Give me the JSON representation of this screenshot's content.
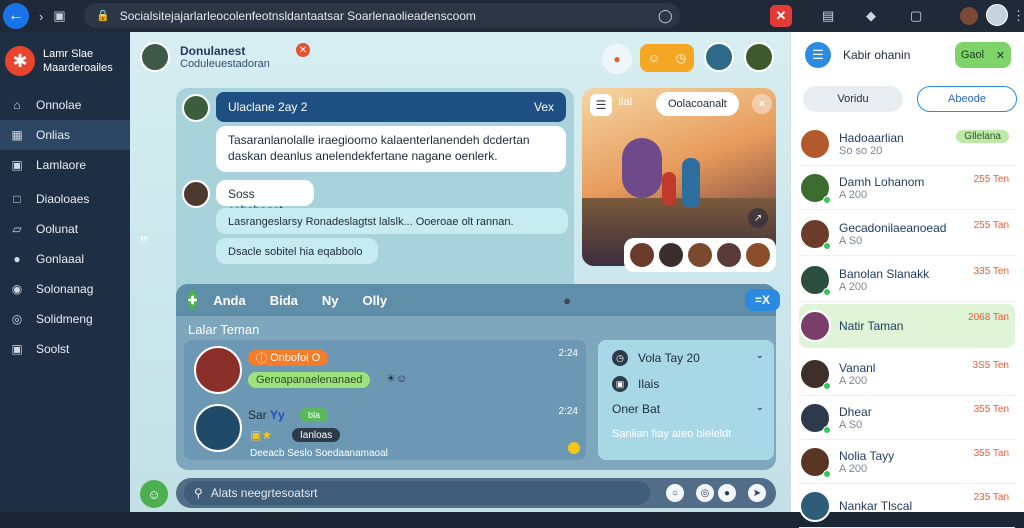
{
  "browser": {
    "url": "Socialsitejajarlarleocolenfeotnsldantaatsar Soarlenaolieadenscoom",
    "back_icon": "arrow-left-icon"
  },
  "sidebar": {
    "brand_line1": "Lamr Slae",
    "brand_line2": "Maarderoailes",
    "items": [
      {
        "label": "Onnolae",
        "icon": "home-icon"
      },
      {
        "label": "Onlias",
        "icon": "grid-icon"
      },
      {
        "label": "Lamlaore",
        "icon": "calendar-icon"
      },
      {
        "label": "Diaoloaes",
        "icon": "document-icon"
      },
      {
        "label": "Oolunat",
        "icon": "chat-icon"
      },
      {
        "label": "Gonlaaal",
        "icon": "settings-icon"
      },
      {
        "label": "Solonanag",
        "icon": "people-icon"
      },
      {
        "label": "Solidmeng",
        "icon": "bell-icon"
      },
      {
        "label": "Soolst",
        "icon": "folder-icon"
      }
    ]
  },
  "header": {
    "title": "Donulanest",
    "subtitle": "Coduleuestadoran"
  },
  "chat": {
    "title": "Ulaclane 2ay 2",
    "close_label": "Vex",
    "message1": "Tasaranlanolalle iraegioomo kalaenterlanendeh dcdertan daskan deanlus anelendekfertane nagane oenlerk.",
    "message2": "Soss cobsbaast",
    "message3": "Lasrangeslarsy Ronadeslagtst lalslk...    Ooeroae olt rannan.",
    "message4": "Dsacle sobitel  hia  eqabbolo"
  },
  "image_card": {
    "title": "Oolacoanalt",
    "badge": "Ilal"
  },
  "friends": {
    "tabs": [
      "Anda",
      "Bida",
      "Ny",
      "Olly"
    ],
    "action_label": "=X",
    "section_title": "Lalar Teman",
    "friend1": {
      "tag": "Onbofol O",
      "detail": "Geroapanaelenanaed",
      "time": "2:24"
    },
    "friend2": {
      "name": "Sar",
      "name_accent": "Yy",
      "tag": "bla",
      "badge": "Ianloas",
      "detail": "Deeacb  Seslo  Soedaanamaoal",
      "time": "2:24"
    },
    "side": {
      "line1": "Vola Tay 20",
      "line2": "Ilais",
      "line3": "Oner  Bat",
      "line4": "Saniian fiay ateo bleleldt"
    }
  },
  "composer": {
    "placeholder": "Alats neegrtesoatsrt"
  },
  "right_panel": {
    "title": "Kabir ohanin",
    "status_label": "Gaol",
    "tab1": "Voridu",
    "tab2": "Abeode",
    "contacts": [
      {
        "name": "Hadoaarlian",
        "sub": "So so 20",
        "time": "Gllelana",
        "online": false,
        "highlight": false,
        "color": "#b35a2c"
      },
      {
        "name": "Damh Lohanom",
        "sub": "A 200",
        "time": "255 Ten",
        "online": true,
        "highlight": false,
        "color": "#3b6b2f"
      },
      {
        "name": "Gecadonilaeanoead",
        "sub": "A  S0",
        "time": "255 Tan",
        "online": true,
        "highlight": false,
        "color": "#6b3c2a"
      },
      {
        "name": "Banolan Slanakk",
        "sub": "A 200",
        "time": "335 Ten",
        "online": true,
        "highlight": false,
        "color": "#2b4e3f"
      },
      {
        "name": "Natir Taman",
        "sub": "",
        "time": "2068 Tan",
        "online": false,
        "highlight": true,
        "color": "#7a3e6a"
      },
      {
        "name": "Vananl",
        "sub": "A 200",
        "time": "3S5 Ten",
        "online": true,
        "highlight": false,
        "color": "#3e2f2a"
      },
      {
        "name": "Dhear",
        "sub": "A  S0",
        "time": "355 Ten",
        "online": true,
        "highlight": false,
        "color": "#2d3a4a"
      },
      {
        "name": "Nolia Tayy",
        "sub": "A 200",
        "time": "355 Tan",
        "online": true,
        "highlight": false,
        "color": "#5a3524"
      },
      {
        "name": "Nankar Tlscal",
        "sub": "",
        "time": "235 Tan",
        "online": false,
        "highlight": false,
        "color": "#2f5c77"
      }
    ]
  }
}
